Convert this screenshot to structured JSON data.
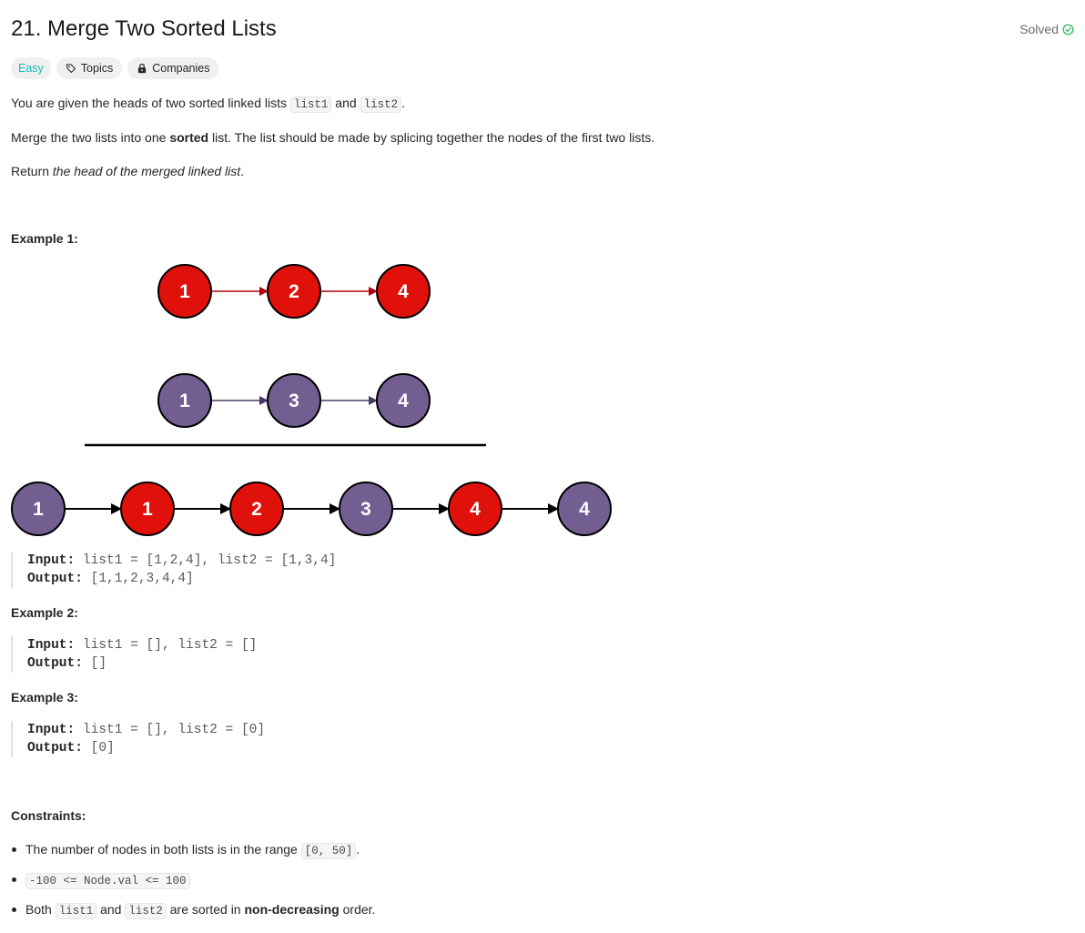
{
  "problem": {
    "title": "21. Merge Two Sorted Lists",
    "solved_label": "Solved",
    "difficulty": "Easy",
    "topics_label": "Topics",
    "companies_label": "Companies"
  },
  "description": {
    "p1_pre": "You are given the heads of two sorted linked lists ",
    "p1_code1": "list1",
    "p1_mid": " and ",
    "p1_code2": "list2",
    "p1_post": ".",
    "p2_pre": "Merge the two lists into one ",
    "p2_bold": "sorted",
    "p2_post": " list. The list should be made by splicing together the nodes of the first two lists.",
    "p3_pre": "Return ",
    "p3_italic": "the head of the merged linked list",
    "p3_post": "."
  },
  "example1": {
    "title": "Example 1:",
    "diagram": {
      "list1": [
        "1",
        "2",
        "4"
      ],
      "list2": [
        "1",
        "3",
        "4"
      ],
      "merged": [
        "1",
        "1",
        "2",
        "3",
        "4",
        "4"
      ],
      "list1_color": "#e0110a",
      "list2_color": "#735e92"
    },
    "input_label": "Input:",
    "input_value": "list1 = [1,2,4], list2 = [1,3,4]",
    "output_label": "Output:",
    "output_value": "[1,1,2,3,4,4]"
  },
  "example2": {
    "title": "Example 2:",
    "input_label": "Input:",
    "input_value": "list1 = [], list2 = []",
    "output_label": "Output:",
    "output_value": "[]"
  },
  "example3": {
    "title": "Example 3:",
    "input_label": "Input:",
    "input_value": "list1 = [], list2 = [0]",
    "output_label": "Output:",
    "output_value": "[0]"
  },
  "constraints": {
    "title": "Constraints:",
    "c1_pre": "The number of nodes in both lists is in the range ",
    "c1_code": "[0, 50]",
    "c1_post": ".",
    "c2_code": "-100 <= Node.val <= 100",
    "c3_pre": "Both ",
    "c3_code1": "list1",
    "c3_mid": " and ",
    "c3_code2": "list2",
    "c3_post1": " are sorted in ",
    "c3_bold": "non-decreasing",
    "c3_post2": " order."
  },
  "colors": {
    "easy": "#1cbaba",
    "solved_check": "#2cbb5d"
  },
  "icons": [
    "checkmark-circle-icon",
    "tag-icon",
    "lock-icon"
  ]
}
